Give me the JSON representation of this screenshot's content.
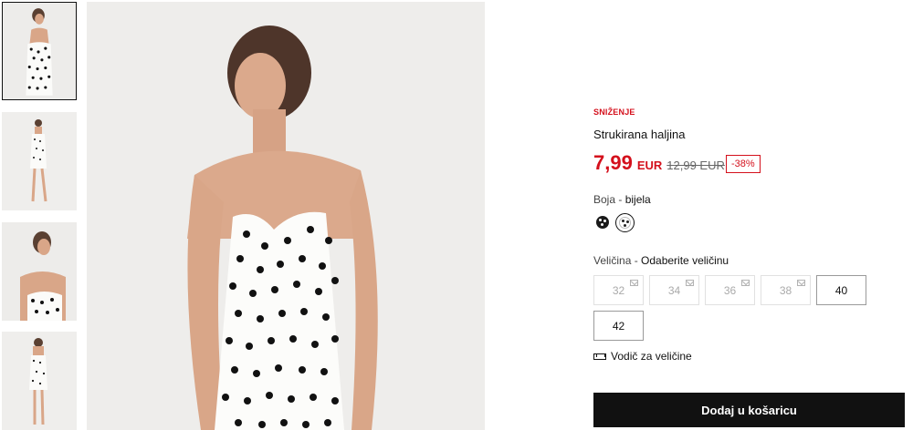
{
  "product": {
    "sale_tag": "SNIŽENJE",
    "title": "Strukirana haljina",
    "price_current": "7,99",
    "currency": "EUR",
    "price_old": "12,99 EUR",
    "discount": "-38%"
  },
  "color": {
    "label": "Boja - ",
    "selected": "bijela",
    "swatches": [
      "black-polka-dot",
      "white-polka-dot"
    ]
  },
  "size": {
    "label": "Veličina - ",
    "prompt": "Odaberite veličinu",
    "options": [
      {
        "label": "32",
        "available": false
      },
      {
        "label": "34",
        "available": false
      },
      {
        "label": "36",
        "available": false
      },
      {
        "label": "38",
        "available": false
      },
      {
        "label": "40",
        "available": true
      },
      {
        "label": "42",
        "available": true
      }
    ],
    "guide_label": "Vodič za veličine"
  },
  "cart": {
    "add_label": "Dodaj u košaricu"
  },
  "colors": {
    "sale_red": "#d4101c",
    "button_black": "#111111"
  }
}
